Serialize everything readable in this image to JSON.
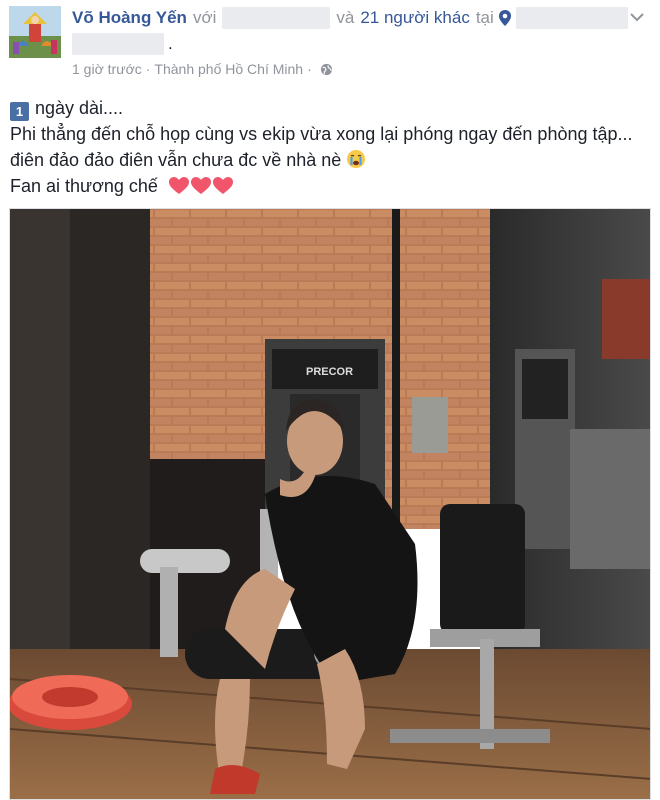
{
  "post": {
    "author": "Võ Hoàng Yến",
    "with_word": "với",
    "and_word": "và",
    "others_link": "21 người khác",
    "at_word": "tại",
    "end_period": ".",
    "time": "1 giờ trước",
    "meta_separator": "·",
    "location": "Thành phố Hồ Chí Minh",
    "privacy_icon": "globe-icon",
    "location_icon": "map-pin-icon",
    "menu_icon": "chevron-down-icon"
  },
  "content": {
    "badge": "1",
    "line1": "ngày dài....",
    "line2": "Phi thẳng đến chỗ họp cùng vs ekip vừa xong lại phóng ngay đến phòng tập... điên đảo đảo điên vẫn chưa đc về nhà nè",
    "emoji": "crying-face",
    "line3": "Fan ai thương chế",
    "hearts": [
      "heart",
      "heart",
      "heart"
    ]
  },
  "photo": {
    "machine_brand": "PRECOR"
  },
  "colors": {
    "link": "#365899",
    "muted": "#90949c",
    "text": "#1d2129",
    "heart": "#f0556b",
    "badge": "#4a6fa5"
  }
}
